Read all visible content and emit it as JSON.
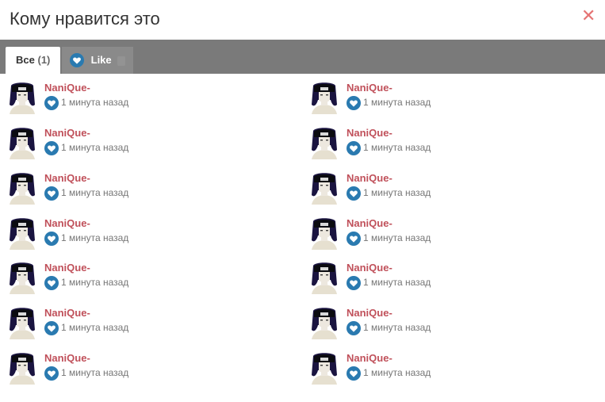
{
  "dialog": {
    "title": "Кому нравится это",
    "close_glyph": "✕"
  },
  "tabs": [
    {
      "label": "Все",
      "count": "(1)"
    },
    {
      "label": "Like",
      "icon": "heart-icon"
    }
  ],
  "colors": {
    "accent": "#2a7ab0",
    "username": "#c0505a",
    "close": "#e57373",
    "tabbar": "#7a7a7a"
  },
  "likers": [
    {
      "name": "NaniQue-",
      "time": "1 минута назад"
    },
    {
      "name": "NaniQue-",
      "time": "1 минута назад"
    },
    {
      "name": "NaniQue-",
      "time": "1 минута назад"
    },
    {
      "name": "NaniQue-",
      "time": "1 минута назад"
    },
    {
      "name": "NaniQue-",
      "time": "1 минута назад"
    },
    {
      "name": "NaniQue-",
      "time": "1 минута назад"
    },
    {
      "name": "NaniQue-",
      "time": "1 минута назад"
    },
    {
      "name": "NaniQue-",
      "time": "1 минута назад"
    },
    {
      "name": "NaniQue-",
      "time": "1 минута назад"
    },
    {
      "name": "NaniQue-",
      "time": "1 минута назад"
    },
    {
      "name": "NaniQue-",
      "time": "1 минута назад"
    },
    {
      "name": "NaniQue-",
      "time": "1 минута назад"
    },
    {
      "name": "NaniQue-",
      "time": "1 минута назад"
    },
    {
      "name": "NaniQue-",
      "time": "1 минута назад"
    }
  ]
}
